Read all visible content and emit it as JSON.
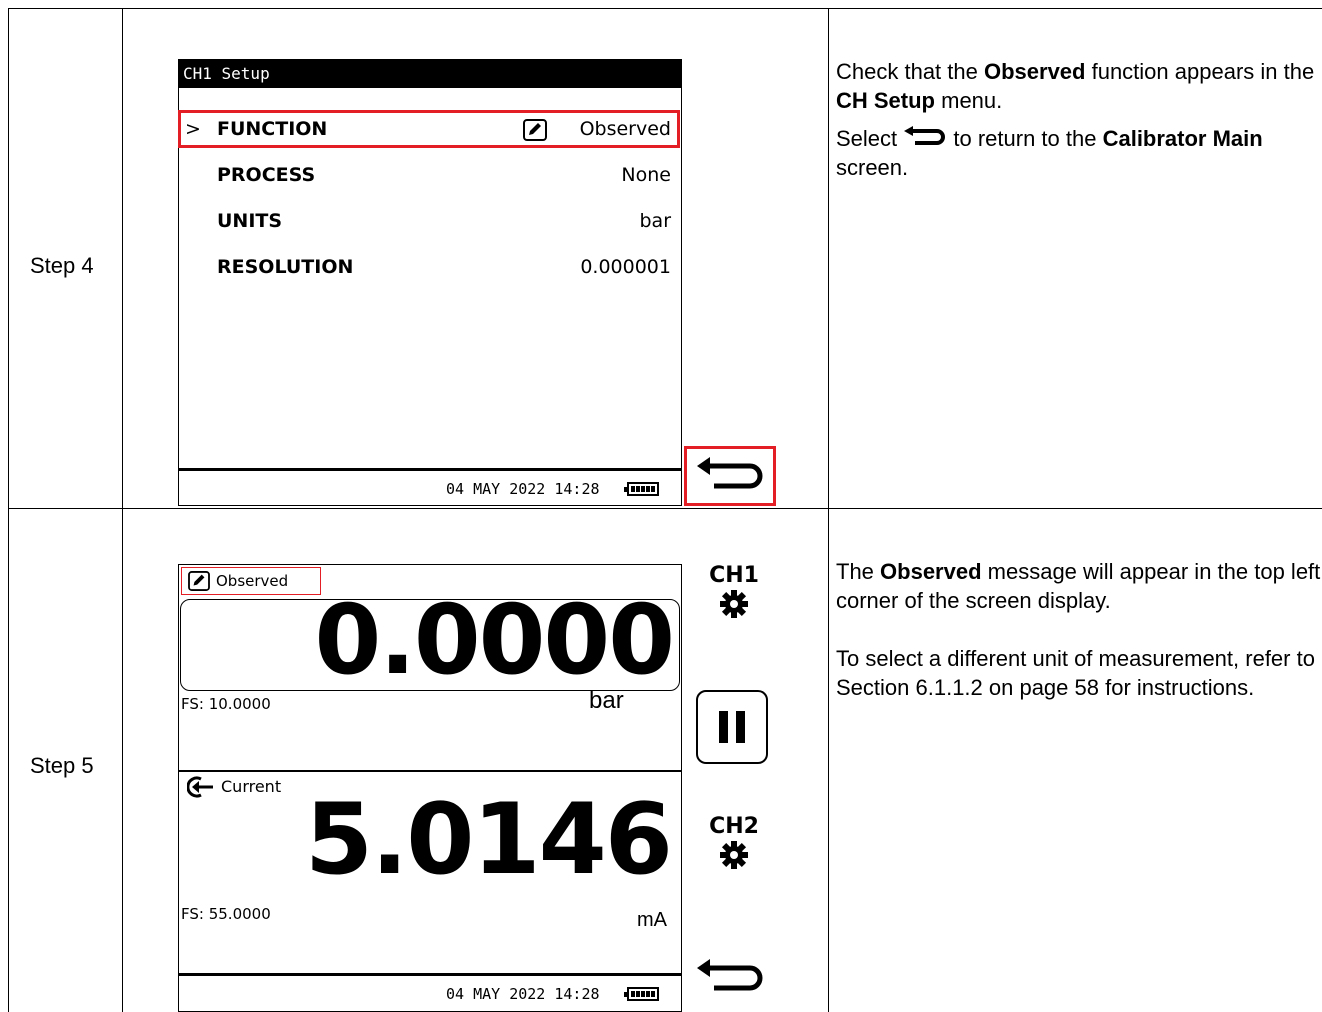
{
  "steps": [
    {
      "label": "Step 4",
      "screen": {
        "title": "CH1 Setup",
        "rows": [
          {
            "label": "FUNCTION",
            "value": "Observed",
            "selected": true
          },
          {
            "label": "PROCESS",
            "value": "None"
          },
          {
            "label": "UNITS",
            "value": "bar"
          },
          {
            "label": "RESOLUTION",
            "value": "0.000001"
          }
        ],
        "status_datetime": "04 MAY 2022 14:28"
      },
      "desc": {
        "p1_pre": "Check that the ",
        "p1_b1": "Observed",
        "p1_mid": " function appears in the ",
        "p1_b2": "CH Setup",
        "p1_post": " menu.",
        "p2_pre": "Select ",
        "p2_mid": " to return to the ",
        "p2_b": "Calibrator Main",
        "p2_post": " screen."
      }
    },
    {
      "label": "Step 5",
      "screen": {
        "tag": "Observed",
        "ch1_value": "0.0000",
        "ch1_fs": "FS: 10.0000",
        "ch1_unit": "bar",
        "ch2_label": "Current",
        "ch2_value": "5.0146",
        "ch2_fs": "FS: 55.0000",
        "ch2_unit": "mA",
        "ch1_btn": "CH1",
        "ch2_btn": "CH2",
        "status_datetime": "04 MAY 2022 14:28"
      },
      "desc": {
        "p1_pre": "The ",
        "p1_b": "Observed",
        "p1_post": " message will appear in the top left corner of the screen display.",
        "p2": "To select a different unit of measurement, refer to Section 6.1.1.2 on page 58 for instructions."
      }
    }
  ],
  "colors": {
    "highlight": "#e31e24"
  }
}
